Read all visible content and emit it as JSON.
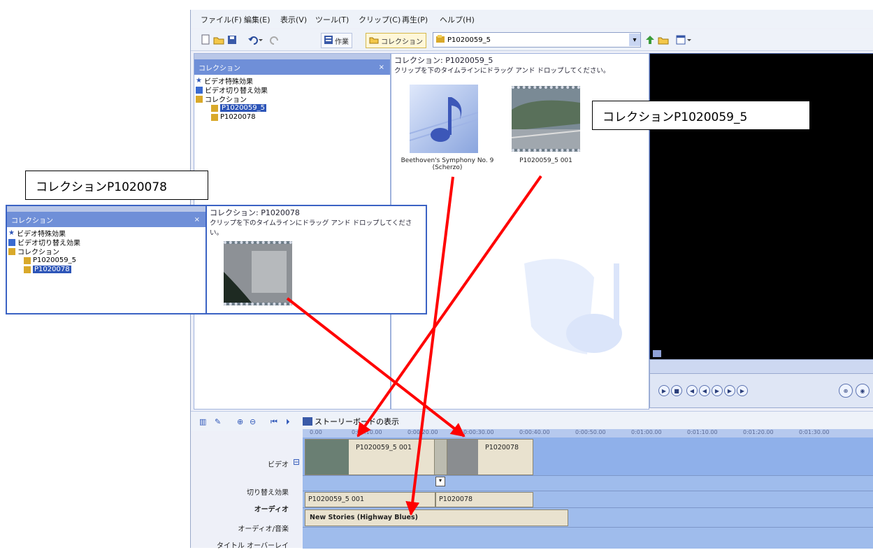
{
  "menu": [
    "ファイル(F)",
    "編集(E)",
    "表示(V)",
    "ツール(T)",
    "クリップ(C)",
    "再生(P)",
    "ヘルプ(H)"
  ],
  "toolbar": {
    "tasks_label": "作業",
    "collections_label": "コレクション",
    "path_value": "P1020059_5"
  },
  "collections_pane": {
    "header": "コレクション",
    "close": "×",
    "tree": [
      {
        "label": "ビデオ特殊効果",
        "icon": "star-icon"
      },
      {
        "label": "ビデオ切り替え効果",
        "icon": "transition-icon"
      },
      {
        "label": "コレクション",
        "icon": "collection-folder-icon"
      },
      {
        "label": "P1020059_5",
        "icon": "collection-folder-icon",
        "selected": true
      },
      {
        "label": "P1020078",
        "icon": "collection-folder-icon",
        "selected": false
      }
    ]
  },
  "content": {
    "title": "コレクション: P1020059_5",
    "subtitle": "クリップを下のタイムラインにドラッグ アンド ドロップしてください。",
    "items": [
      {
        "caption": "Beethoven's Symphony No. 9 (Scherzo)",
        "kind": "audio"
      },
      {
        "caption": "P1020059_5 001",
        "kind": "video"
      }
    ]
  },
  "popout": {
    "header": "コレクション",
    "close": "×",
    "tree": [
      {
        "label": "ビデオ特殊効果",
        "icon": "star-icon"
      },
      {
        "label": "ビデオ切り替え効果",
        "icon": "transition-icon"
      },
      {
        "label": "コレクション",
        "icon": "collection-folder-icon"
      },
      {
        "label": "P1020059_5",
        "icon": "collection-folder-icon",
        "selected": false
      },
      {
        "label": "P1020078",
        "icon": "collection-folder-icon",
        "selected": true
      }
    ],
    "title": "コレクション: P1020078",
    "subtitle": "クリップを下のタイムラインにドラッグ アンド ドロップしてください。"
  },
  "callouts": {
    "right": "コレクションP1020059_5",
    "left": "コレクションP1020078"
  },
  "timeline": {
    "storyboard_label": "ストーリーボードの表示",
    "ruler_ticks": [
      "0.00",
      "0:00:10.00",
      "0:00:20.00",
      "0:00:30.00",
      "0:00:40.00",
      "0:00:50.00",
      "0:01:00.00",
      "0:01:10.00",
      "0:01:20.00",
      "0:01:30.00"
    ],
    "tracks": {
      "video": "ビデオ",
      "video_expand": "⊟",
      "transition": "切り替え効果",
      "audio": "オーディオ",
      "music": "オーディオ/音楽",
      "title": "タイトル オーバーレイ"
    },
    "clips": {
      "video1": "P1020059_5 001",
      "video2": "P1020078",
      "audio1": "P1020059_5 001",
      "audio2": "P1020078",
      "music": "New Stories (Highway Blues)"
    }
  },
  "colors": {
    "arrow": "#ff0000",
    "header_blue": "#6f8fd8",
    "timeline_blue": "#8fb0ea"
  }
}
